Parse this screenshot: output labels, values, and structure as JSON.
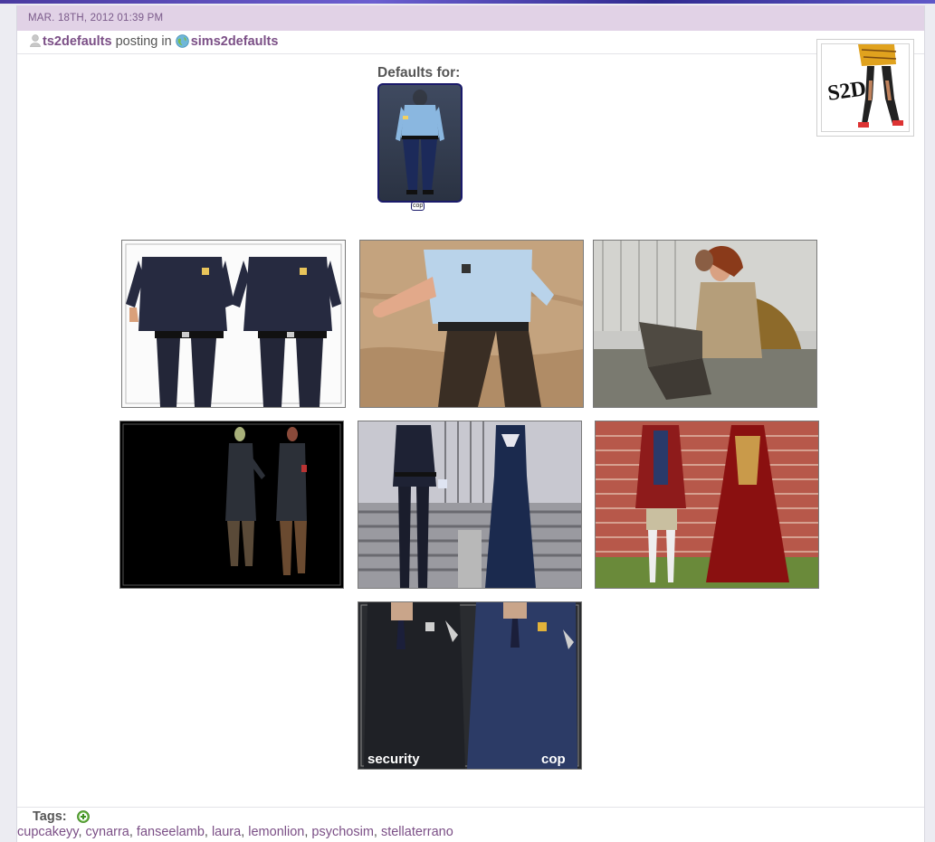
{
  "post": {
    "date": "MAR. 18TH, 2012 01:39 PM",
    "username": "ts2defaults",
    "posting_in": "posting in",
    "community": "sims2defaults",
    "avatar_text": "S2D"
  },
  "defaults": {
    "title": "Defaults for:",
    "item_label": "cop"
  },
  "previews": {
    "security_label": "security",
    "cop_label": "cop"
  },
  "tags": {
    "title": "Tags:",
    "items": [
      "cupcakeyy",
      "cynarra",
      "fanseelamb",
      "laura",
      "lemonlion",
      "psychosim",
      "stellaterrano"
    ]
  },
  "icons": {
    "user": "user-icon",
    "community": "globe-icon",
    "add_tag": "plus-circle-icon"
  }
}
